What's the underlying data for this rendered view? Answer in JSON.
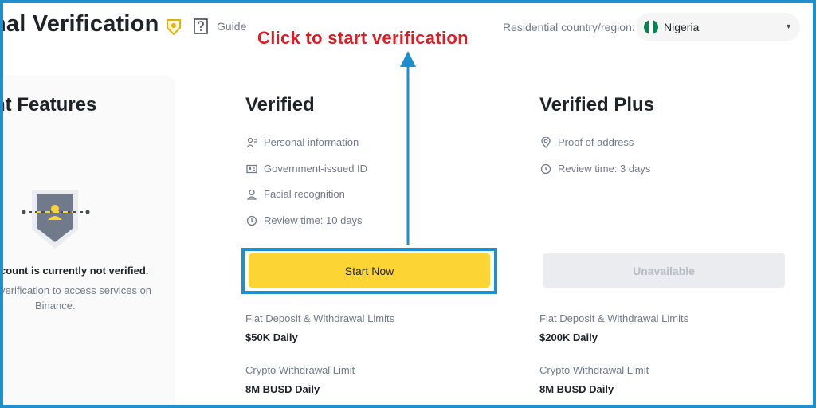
{
  "header": {
    "title": "nal Verification",
    "guide_label": "Guide",
    "country_label": "Residential country/region:",
    "country_value": "Nigeria",
    "flag_colors": [
      "#008751",
      "#ffffff",
      "#008751"
    ]
  },
  "annotation": {
    "text": "Click to start verification",
    "color": "#d81f26",
    "highlight_color": "#1d8fcf"
  },
  "left_panel": {
    "title": "nt Features",
    "status": "count is currently not verified.",
    "desc_line1": "verification to access services on",
    "desc_line2": "Binance."
  },
  "verified": {
    "title": "Verified",
    "features": [
      {
        "icon": "person-info-icon",
        "text": "Personal information"
      },
      {
        "icon": "id-card-icon",
        "text": "Government-issued ID"
      },
      {
        "icon": "face-icon",
        "text": "Facial recognition"
      },
      {
        "icon": "clock-icon",
        "text": "Review time: 10 days"
      }
    ],
    "button": "Start Now",
    "fiat_label": "Fiat Deposit & Withdrawal Limits",
    "fiat_value": "$50K Daily",
    "crypto_label": "Crypto Withdrawal Limit",
    "crypto_value": "8M BUSD Daily"
  },
  "verified_plus": {
    "title": "Verified Plus",
    "features": [
      {
        "icon": "location-icon",
        "text": "Proof of address"
      },
      {
        "icon": "clock-icon",
        "text": "Review time: 3 days"
      }
    ],
    "button": "Unavailable",
    "fiat_label": "Fiat Deposit & Withdrawal Limits",
    "fiat_value": "$200K Daily",
    "crypto_label": "Crypto Withdrawal Limit",
    "crypto_value": "8M BUSD Daily"
  },
  "colors": {
    "accent_yellow": "#fcd535",
    "text_primary": "#1e2329",
    "text_secondary": "#707a8a"
  }
}
